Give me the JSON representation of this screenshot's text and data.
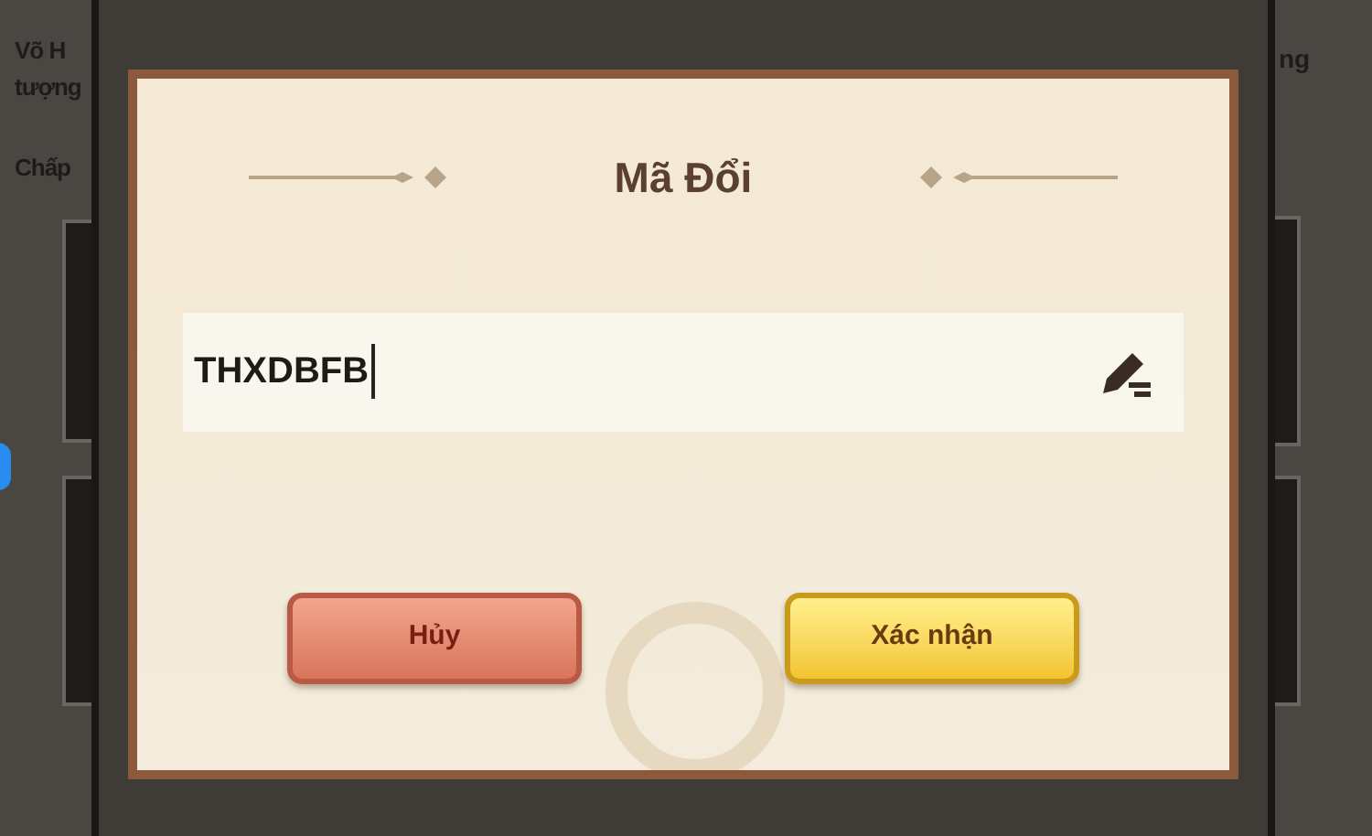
{
  "background": {
    "left_lines": [
      "Võ H",
      "tượng",
      "Chấp"
    ],
    "right_lines": [
      "ng"
    ]
  },
  "dialog": {
    "title": "Mã Đổi",
    "code_field": {
      "value": "THXDBFB"
    },
    "buttons": [
      {
        "label": "Hủy",
        "kind": "cancel"
      },
      {
        "label": "Xác nhận",
        "kind": "confirm"
      }
    ]
  }
}
